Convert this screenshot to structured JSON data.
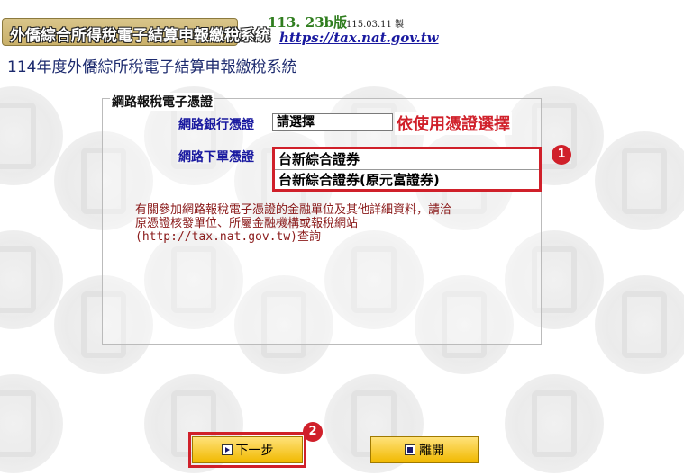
{
  "header": {
    "logo_text": "外僑綜合所得稅電子結算申報繳稅系統",
    "version": "113. 23b版",
    "version_date": "115.03.11 製",
    "site_url": "https://tax.nat.gov.tw"
  },
  "page_title": "114年度外僑綜所稅電子結算申報繳稅系統",
  "section": {
    "label": "網路報稅電子憑證",
    "bank_cert_label": "網路銀行憑證",
    "bank_cert_value": "請選擇",
    "hint": "依使用憑證選擇",
    "broker_cert_label": "網路下單憑證",
    "broker_options": [
      "台新綜合證券",
      "台新綜合證券(原元富證券)"
    ]
  },
  "info_lines": [
    "有關參加網路報稅電子憑證的金融單位及其他詳細資料，請洽",
    "原憑證核發單位、所屬金融機構或報稅網站",
    "(http://tax.nat.gov.tw)查詢"
  ],
  "badges": {
    "one": "1",
    "two": "2"
  },
  "buttons": {
    "next": "下一步",
    "exit": "離開"
  },
  "colors": {
    "accent_red": "#d0202a",
    "link_blue": "#1a1aa0",
    "button_gold": "#f1b900"
  }
}
